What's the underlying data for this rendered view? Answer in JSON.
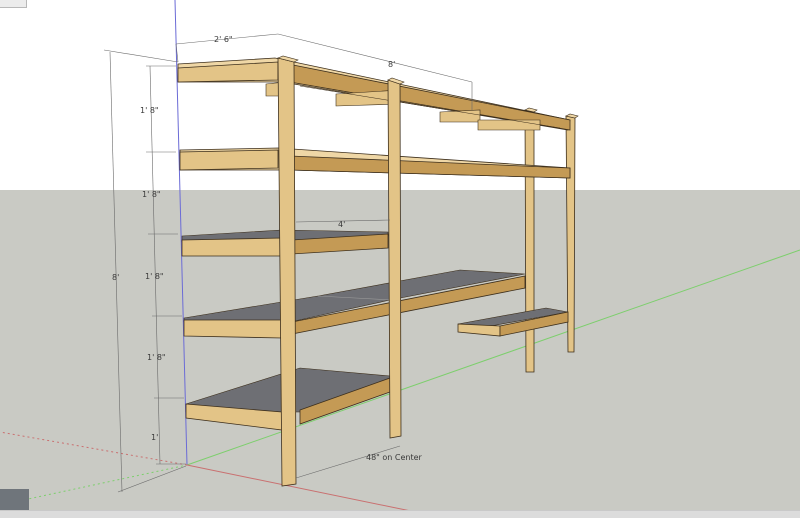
{
  "dimensions": {
    "depth": "2' 6\"",
    "length": "8'",
    "overall_height": "8'",
    "span_1": "1' 8\"",
    "span_2": "1' 8\"",
    "span_3": "1' 8\"",
    "span_4": "1' 8\"",
    "span_5": "1'",
    "shelf_width": "4'",
    "post_spacing": "48\" on Center"
  },
  "colors": {
    "sky": "#ffffff",
    "ground": "#c9cac4",
    "wood_front": "#e3c487",
    "wood_side": "#c49a55",
    "wood_top": "#efd7a6",
    "wood_edge": "#3d2f1c",
    "plywood_top": "#6e6f74",
    "blue_axis": "#6b6bd6",
    "green_axis": "#7ccf6c",
    "red_axis": "#c97070"
  }
}
